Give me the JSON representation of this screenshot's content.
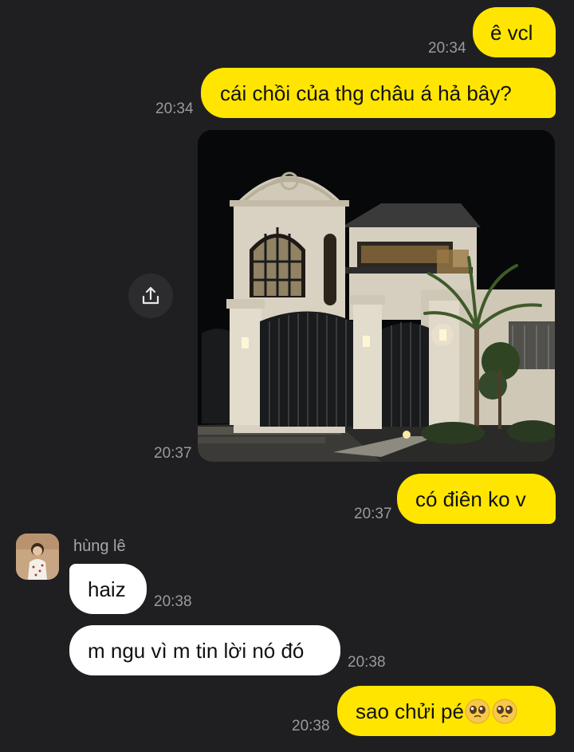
{
  "colors": {
    "background": "#1f1f21",
    "outgoing_bubble": "#ffe500",
    "incoming_bubble": "#ffffff",
    "timestamp": "#9a9a9e"
  },
  "messages": {
    "m1": {
      "text": "ê vcl",
      "time": "20:34",
      "direction": "outgoing"
    },
    "m2": {
      "text": "cái chồi của thg châu á hả bây?",
      "time": "20:34",
      "direction": "outgoing"
    },
    "photo": {
      "time": "20:37",
      "direction": "outgoing",
      "share_icon": "share-icon"
    },
    "m3": {
      "text": "có điên ko v",
      "time": "20:37",
      "direction": "outgoing"
    },
    "m4": {
      "text": "haiz",
      "time": "20:38",
      "direction": "incoming"
    },
    "m5": {
      "text": "m ngu vì m tin lời nó đó",
      "time": "20:38",
      "direction": "incoming"
    },
    "m6": {
      "text": "sao chửi pé",
      "emoji": "🥹🥹",
      "time": "20:38",
      "direction": "outgoing"
    }
  },
  "contact": {
    "name": "hùng lê",
    "avatar_icon": "person-avatar"
  }
}
